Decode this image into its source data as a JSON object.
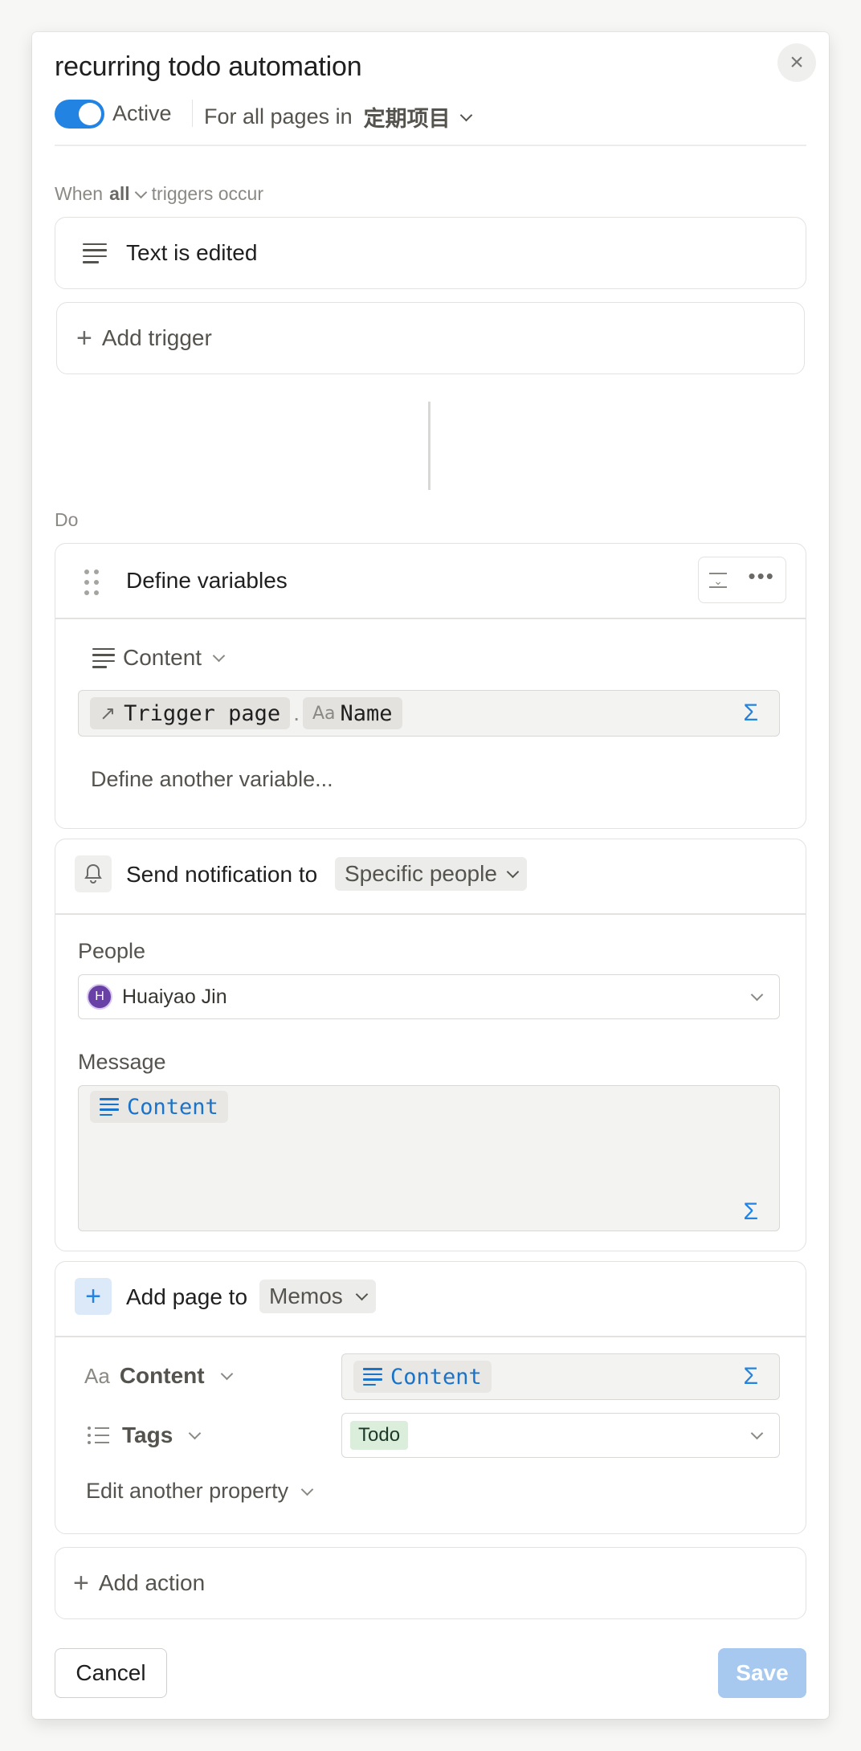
{
  "header": {
    "title": "recurring todo automation",
    "active_label": "Active",
    "scope_text": "For all pages in",
    "database": "定期项目"
  },
  "triggers": {
    "when_prefix": "When",
    "mode": "all",
    "suffix": "triggers occur",
    "items": [
      {
        "bold": "Text",
        "rest": "is edited"
      }
    ],
    "add_label": "Add trigger"
  },
  "do_label": "Do",
  "define_variables": {
    "title": "Define variables",
    "variable_name": "Content",
    "pill_source": "Trigger page",
    "dot": ".",
    "aa": "Aa",
    "pill_property": "Name",
    "sigma": "Σ",
    "add_label": "Define another variable..."
  },
  "send_notification": {
    "title": "Send notification to",
    "target": "Specific people",
    "people_label": "People",
    "person_initial": "H",
    "person_name": "Huaiyao Jin",
    "message_label": "Message",
    "message_token": "Content",
    "sigma": "Σ"
  },
  "add_page": {
    "title": "Add page to",
    "target": "Memos",
    "props": [
      {
        "icon": "Aa",
        "name": "Content",
        "value_token": "Content"
      },
      {
        "name": "Tags",
        "value_tag": "Todo"
      }
    ],
    "edit_another": "Edit another property",
    "sigma": "Σ"
  },
  "add_action_label": "Add action",
  "footer": {
    "cancel": "Cancel",
    "save": "Save"
  },
  "colors": {
    "accent": "#2383e2",
    "save_disabled": "#a7c9f0",
    "tag_green": "#dbeddb",
    "avatar": "#6940a5"
  }
}
